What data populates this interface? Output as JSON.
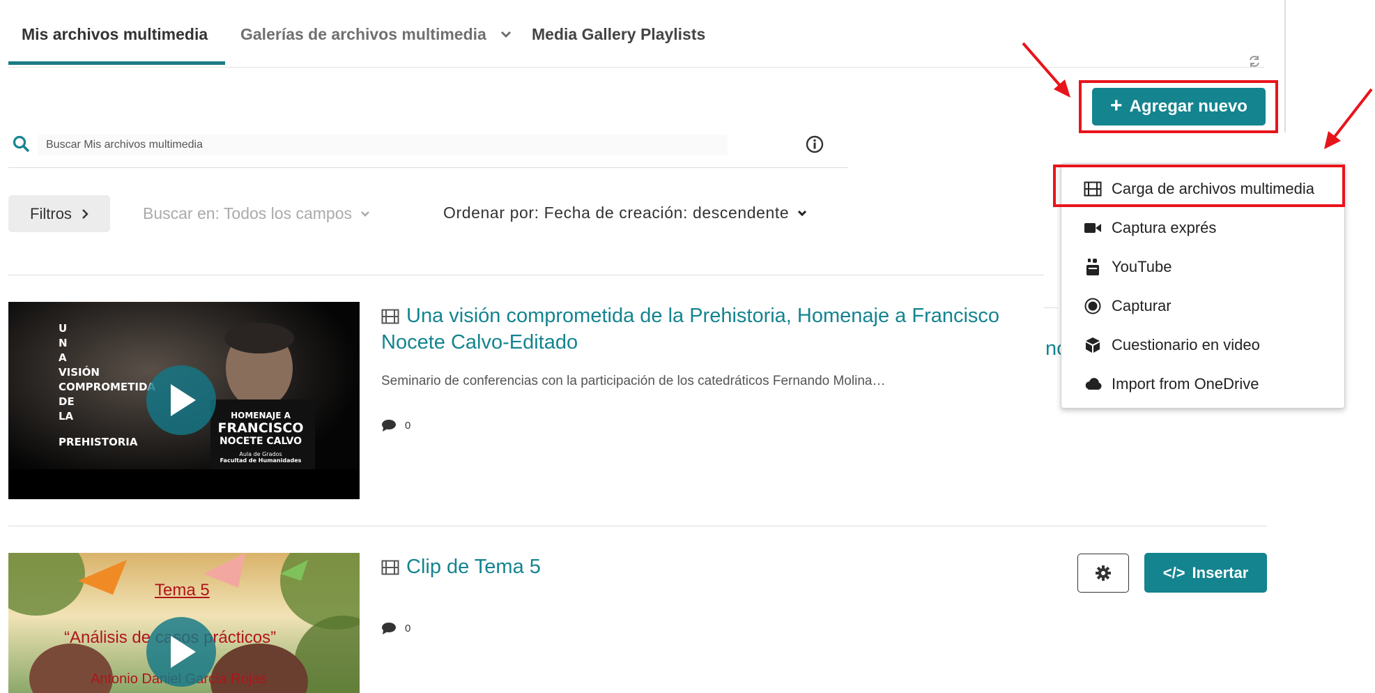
{
  "tabs": [
    {
      "label": "Mis archivos multimedia",
      "active": true
    },
    {
      "label": "Galerías de archivos multimedia",
      "active": false
    },
    {
      "label": "Media Gallery Playlists",
      "active": false
    }
  ],
  "toolbar": {
    "add_new_label": "Agregar nuevo"
  },
  "search": {
    "placeholder": "Buscar Mis archivos multimedia"
  },
  "filters": {
    "filters_label": "Filtros",
    "search_in_label": "Buscar en: Todos los campos",
    "sort_label": "Ordenar por: Fecha de creación: descendente"
  },
  "add_new_menu": {
    "items": [
      {
        "label": "Carga de archivos multimedia",
        "icon": "film-icon"
      },
      {
        "label": "Captura exprés",
        "icon": "video-camera-icon"
      },
      {
        "label": "YouTube",
        "icon": "youtube-icon"
      },
      {
        "label": "Capturar",
        "icon": "record-icon"
      },
      {
        "label": "Cuestionario en video",
        "icon": "cube-icon"
      },
      {
        "label": "Import from OneDrive",
        "icon": "cloud-icon"
      }
    ]
  },
  "entries": [
    {
      "title": "Una visión comprometida de la Prehistoria, Homenaje a Francisco Nocete Calvo-Editado",
      "description": "Seminario de conferencias con la participación de los catedráticos Fernando Molina…",
      "comments": "0",
      "partial_button_text": "nc",
      "thumbnail": {
        "left_text": [
          "U",
          "N",
          "A",
          "VISIÓN",
          "COMPROMETIDA",
          "DE",
          "LA",
          "PREHISTORIA"
        ],
        "homenaje": "HOMENAJE A",
        "name1": "FRANCISCO",
        "name2": "NOCETE CALVO",
        "venue1": "Aula de Grados",
        "venue2": "Facultad de Humanidades"
      }
    },
    {
      "title": "Clip de Tema 5",
      "comments": "0",
      "insert_label": "Insertar",
      "thumbnail": {
        "line1": "Tema 5",
        "line2": "“Análisis de casos prácticos”",
        "line3": "Antonio Daniel García Rojas"
      }
    }
  ],
  "colors": {
    "accent": "#14848f",
    "highlight": "#e8141b"
  }
}
